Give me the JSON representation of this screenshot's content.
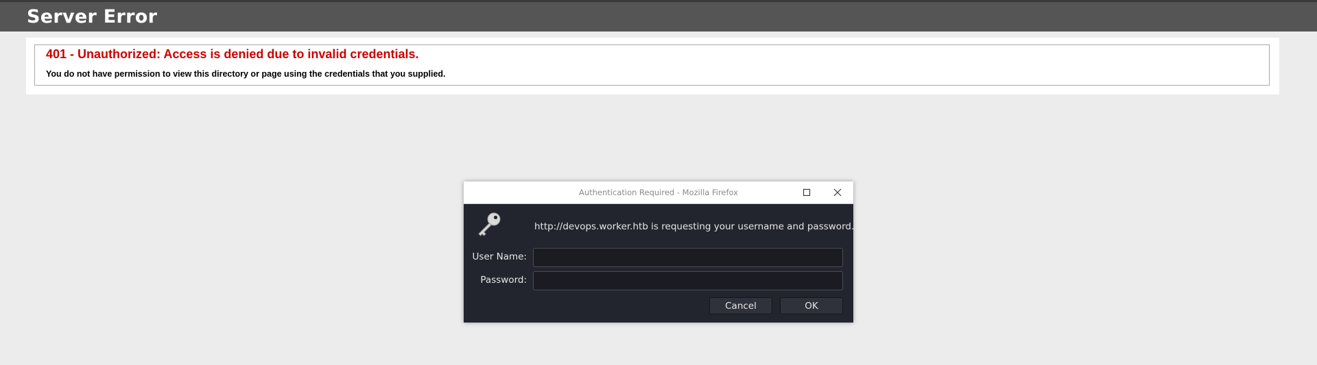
{
  "page": {
    "header_title": "Server Error",
    "error_title": "401 - Unauthorized: Access is denied due to invalid credentials.",
    "error_description": "You do not have permission to view this directory or page using the credentials that you supplied."
  },
  "dialog": {
    "title": "Authentication Required - Mozilla Firefox",
    "message": "http://devops.worker.htb is requesting your username and password.",
    "username_label": "User Name:",
    "username_value": "",
    "password_label": "Password:",
    "password_value": "",
    "cancel_label": "Cancel",
    "ok_label": "OK",
    "icons": {
      "key": "key-icon",
      "maximize": "maximize-icon",
      "close": "close-icon"
    }
  },
  "colors": {
    "header_bg": "#555555",
    "error_red": "#cc0000",
    "page_bg": "#ececec",
    "dialog_body_bg": "#23252e"
  }
}
